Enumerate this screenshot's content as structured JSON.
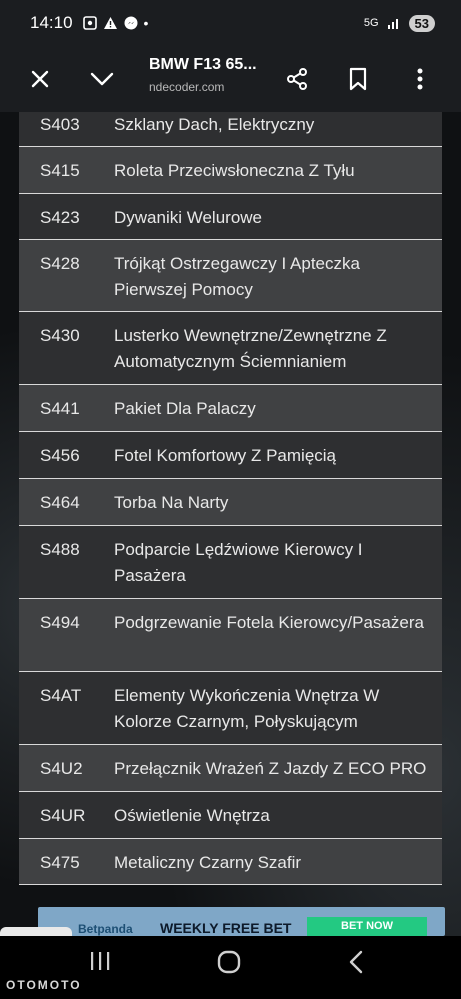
{
  "status_bar": {
    "time": "14:10",
    "network": "5G",
    "battery": "53"
  },
  "toolbar": {
    "title": "BMW F13 65...",
    "url": "ndecoder.com"
  },
  "options": [
    {
      "code": "S403",
      "desc": "Szklany Dach, Elektryczny"
    },
    {
      "code": "S415",
      "desc": "Roleta Przeciwsłoneczna Z Tyłu"
    },
    {
      "code": "S423",
      "desc": "Dywaniki Welurowe"
    },
    {
      "code": "S428",
      "desc": "Trójkąt Ostrzegawczy I Apteczka Pierwszej Pomocy"
    },
    {
      "code": "S430",
      "desc": "Lusterko Wewnętrzne/Zewnętrzne Z Automatycznym Ściemnianiem"
    },
    {
      "code": "S441",
      "desc": "Pakiet Dla Palaczy"
    },
    {
      "code": "S456",
      "desc": "Fotel Komfortowy Z Pamięcią"
    },
    {
      "code": "S464",
      "desc": "Torba Na Narty"
    },
    {
      "code": "S488",
      "desc": "Podparcie Lędźwiowe Kierowcy I Pasażera"
    },
    {
      "code": "S494",
      "desc": "Podgrzewanie Fotela Kierowcy/Pasażera"
    },
    {
      "code": "S4AT",
      "desc": "Elementy Wykończenia Wnętrza W Kolorze Czarnym, Połyskującym"
    },
    {
      "code": "S4U2",
      "desc": "Przełącznik Wrażeń Z Jazdy Z ECO PRO"
    },
    {
      "code": "S4UR",
      "desc": "Oświetlenie Wnętrza"
    },
    {
      "code": "S475",
      "desc": "Metaliczny Czarny Szafir"
    }
  ],
  "ad": {
    "brand": "Betpanda",
    "headline": "WEEKLY FREE BET",
    "cta": "BET NOW"
  },
  "watermark": "OTOMOTO",
  "colors": {
    "row_odd": "#2e2f31",
    "row_even": "#404143",
    "divider": "#d9d9d9",
    "toolbar": "#1b1d20"
  }
}
